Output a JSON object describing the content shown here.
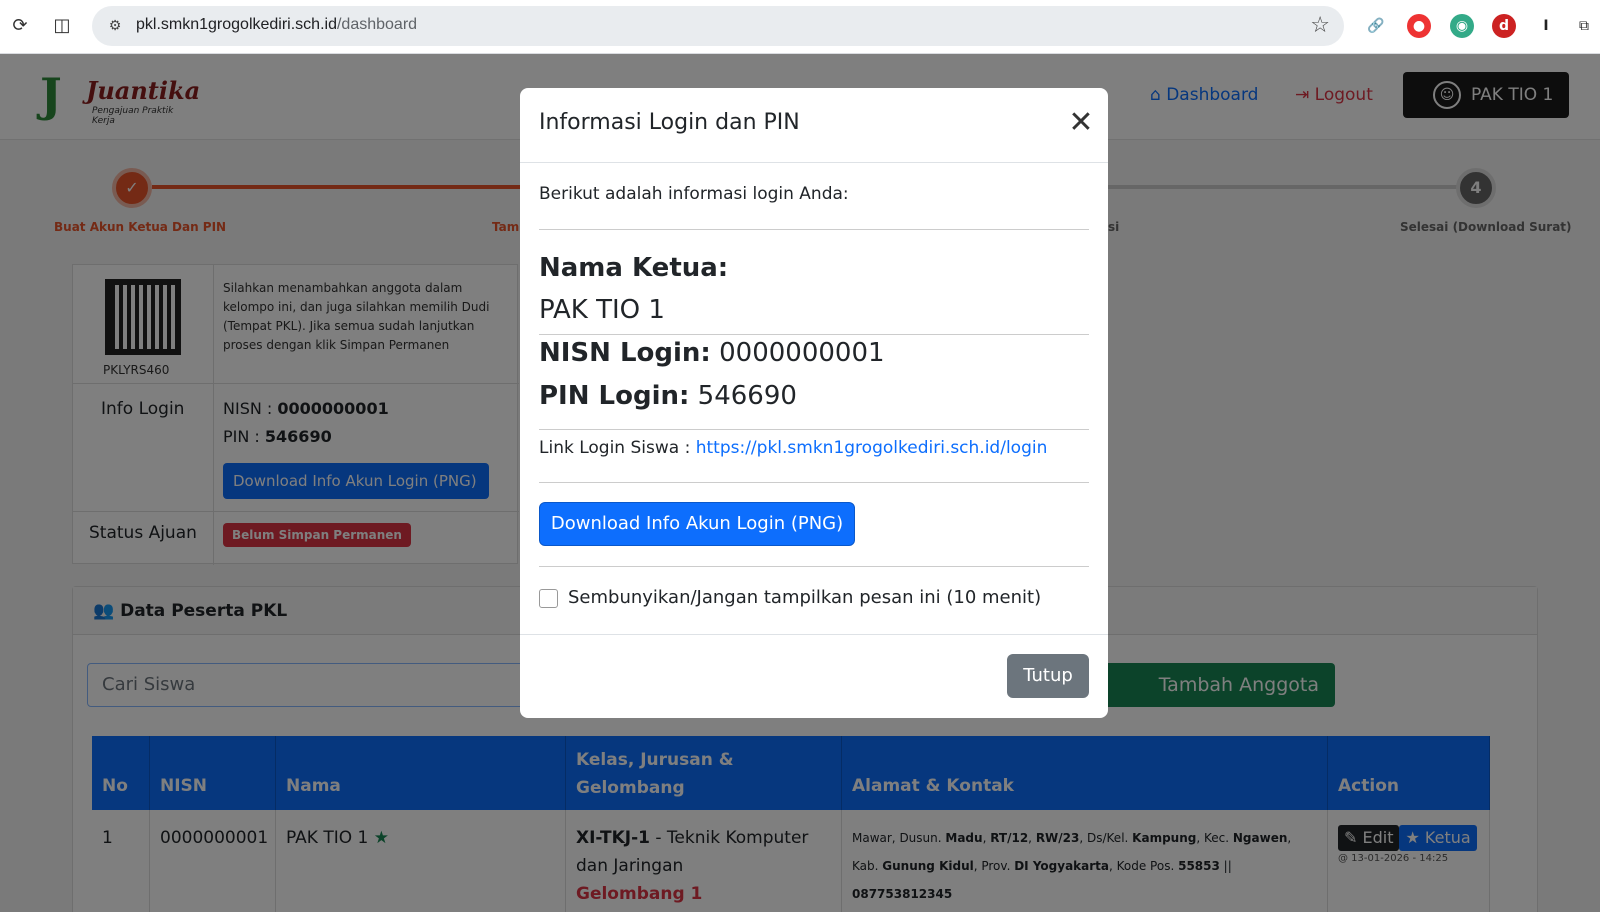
{
  "browser": {
    "url_host": "pkl.smkn1grogolkediri.sch.id",
    "url_path": "/dashboard"
  },
  "site": {
    "logo_name": "Juantika",
    "logo_tagline": "Pengajuan Praktik Kerja"
  },
  "nav": {
    "dashboard": "Dashboard",
    "logout": "Logout",
    "user": "PAK TIO 1"
  },
  "steps": [
    {
      "label": "Buat Akun Ketua Dan PIN",
      "number": "✓"
    },
    {
      "label": "Tamb",
      "number": ""
    },
    {
      "label": "si",
      "number": ""
    },
    {
      "label": "Selesai (Download Surat)",
      "number": "4"
    }
  ],
  "info_card": {
    "qr_code": "PKLYRS460",
    "description": "Silahkan menambahkan anggota dalam kelompo ini, dan juga silahkan memilih Dudi (Tempat PKL). Jika semua sudah lanjutkan proses dengan klik Simpan Permanen",
    "info_login_label": "Info Login",
    "nisn_label": "NISN : ",
    "nisn_value": "0000000001",
    "pin_label": "PIN : ",
    "pin_value": "546690",
    "download_btn": "Download Info Akun Login (PNG)",
    "status_label": "Status Ajuan",
    "status_badge": "Belum Simpan Permanen"
  },
  "peserta": {
    "title": "Data Peserta PKL",
    "search_placeholder": "Cari Siswa",
    "add_btn": "Tambah Anggota"
  },
  "table": {
    "headers": [
      "No",
      "NISN",
      "Nama",
      "Kelas, Jurusan & Gelombang",
      "Alamat & Kontak",
      "Action"
    ],
    "row": {
      "no": "1",
      "nisn": "0000000001",
      "nama": "PAK TIO 1",
      "kelas_code": "XI-TKJ-1",
      "kelas_rest": " - Teknik Komputer dan Jaringan",
      "gelombang": "Gelombang 1",
      "alamat_1": "Mawar, Dusun.",
      "alamat_dusun": "Madu",
      "alamat_rt": "RT/12",
      "alamat_rw": "RW/23",
      "alamat_desa_label": ", Ds/Kel.",
      "alamat_desa": "Kampung",
      "alamat_kec_label": ", Kec.",
      "alamat_kec": "Ngawen",
      "alamat_kab_label": ", Kab.",
      "alamat_kab": "Gunung Kidul",
      "alamat_prov_label": ", Prov.",
      "alamat_prov": "DI Yogyakarta",
      "alamat_kodepos_label": ", Kode Pos.",
      "alamat_kodepos": "55853",
      "alamat_sep": " || ",
      "phone": "087753812345",
      "edit_btn": "Edit",
      "ketua_btn": "Ketua",
      "timestamp": "@ 13-01-2026 - 14:25"
    }
  },
  "modal": {
    "title": "Informasi Login dan PIN",
    "intro": "Berikut adalah informasi login Anda:",
    "nama_ketua_label": "Nama Ketua:",
    "nama_ketua_value": "PAK TIO 1",
    "nisn_label": "NISN Login:",
    "nisn_value": "0000000001",
    "pin_label": "PIN Login:",
    "pin_value": "546690",
    "link_label": "Link Login Siswa : ",
    "link_url": "https://pkl.smkn1grogolkediri.sch.id/login",
    "download_btn": "Download Info Akun Login (PNG)",
    "hide_label": "Sembunyikan/Jangan tampilkan pesan ini (10 menit)",
    "close_btn": "Tutup"
  },
  "colors": {
    "primary": "#0d6efd",
    "danger": "#dc3545",
    "success": "#198754",
    "secondary": "#6c757d",
    "step_active": "#e8542a"
  },
  "icons": {
    "reload": "reload-icon",
    "split": "split-view-icon",
    "site_settings": "site-settings-icon",
    "bookmark": "star-icon",
    "close": "close-icon"
  }
}
